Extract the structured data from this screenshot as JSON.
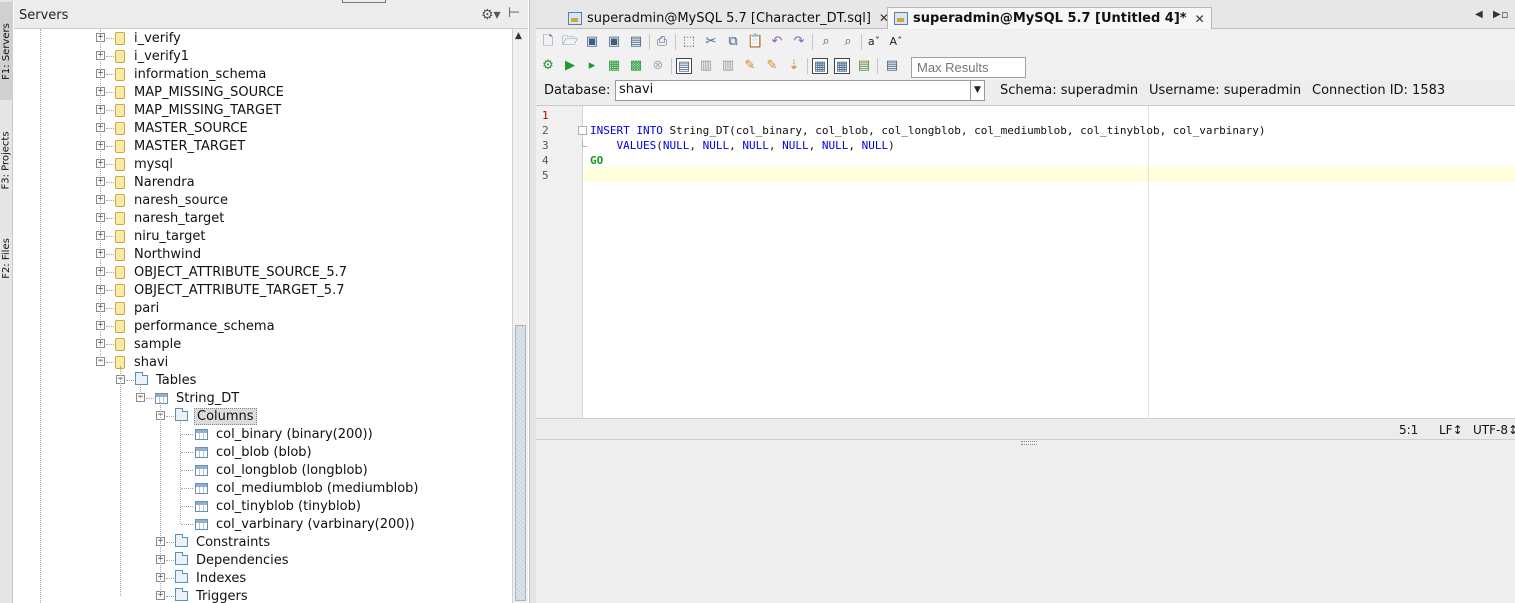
{
  "side_tabs": {
    "servers": "F1: Servers",
    "projects": "F3: Projects",
    "files": "F2: Files"
  },
  "servers_panel": {
    "title": "Servers",
    "tree": [
      {
        "label": "i_verify",
        "type": "database",
        "expanded": false
      },
      {
        "label": "i_verify1",
        "type": "database",
        "expanded": false
      },
      {
        "label": "information_schema",
        "type": "database",
        "expanded": false
      },
      {
        "label": "MAP_MISSING_SOURCE",
        "type": "database",
        "expanded": false
      },
      {
        "label": "MAP_MISSING_TARGET",
        "type": "database",
        "expanded": false
      },
      {
        "label": "MASTER_SOURCE",
        "type": "database",
        "expanded": false
      },
      {
        "label": "MASTER_TARGET",
        "type": "database",
        "expanded": false
      },
      {
        "label": "mysql",
        "type": "database",
        "expanded": false
      },
      {
        "label": "Narendra",
        "type": "database",
        "expanded": false
      },
      {
        "label": "naresh_source",
        "type": "database",
        "expanded": false
      },
      {
        "label": "naresh_target",
        "type": "database",
        "expanded": false
      },
      {
        "label": "niru_target",
        "type": "database",
        "expanded": false
      },
      {
        "label": "Northwind",
        "type": "database",
        "expanded": false
      },
      {
        "label": "OBJECT_ATTRIBUTE_SOURCE_5.7",
        "type": "database",
        "expanded": false
      },
      {
        "label": "OBJECT_ATTRIBUTE_TARGET_5.7",
        "type": "database",
        "expanded": false
      },
      {
        "label": "pari",
        "type": "database",
        "expanded": false
      },
      {
        "label": "performance_schema",
        "type": "database",
        "expanded": false
      },
      {
        "label": "sample",
        "type": "database",
        "expanded": false
      },
      {
        "label": "shavi",
        "type": "database",
        "expanded": true
      },
      {
        "label": "Tables",
        "type": "folder",
        "expanded": true
      },
      {
        "label": "String_DT",
        "type": "table",
        "expanded": true
      },
      {
        "label": "Columns",
        "type": "folder",
        "expanded": true,
        "selected": true
      },
      {
        "label": "col_binary (binary(200))",
        "type": "column"
      },
      {
        "label": "col_blob (blob)",
        "type": "column"
      },
      {
        "label": "col_longblob (longblob)",
        "type": "column"
      },
      {
        "label": "col_mediumblob (mediumblob)",
        "type": "column"
      },
      {
        "label": "col_tinyblob (tinyblob)",
        "type": "column"
      },
      {
        "label": "col_varbinary (varbinary(200))",
        "type": "column"
      },
      {
        "label": "Constraints",
        "type": "folder",
        "expanded": false
      },
      {
        "label": "Dependencies",
        "type": "folder",
        "expanded": false
      },
      {
        "label": "Indexes",
        "type": "folder",
        "expanded": false
      },
      {
        "label": "Triggers",
        "type": "folder",
        "expanded": false
      }
    ]
  },
  "editor_tabs": [
    {
      "label": "superadmin@MySQL 5.7  [Character_DT.sql]",
      "active": false
    },
    {
      "label": "superadmin@MySQL 5.7 [Untitled 4]*",
      "active": true
    }
  ],
  "toolbar": {
    "max_results_placeholder": "Max Results"
  },
  "db_bar": {
    "database_label": "Database:",
    "database_value": "shavi",
    "schema": "Schema:  superadmin",
    "username": "Username:  superadmin",
    "connection_id": "Connection ID:  1583"
  },
  "editor": {
    "line_numbers": [
      "1",
      "2",
      "3",
      "4",
      "5"
    ],
    "line2_kw1": "INSERT",
    "line2_kw2": "INTO",
    "line2_rest": " String_DT(col_binary, col_blob, col_longblob, col_mediumblob, col_tinyblob, col_varbinary)",
    "line3_indent": "    ",
    "line3_kw": "VALUES",
    "line3_rest_open": "(",
    "null_kw": "NULL",
    "line3_close": ")",
    "line4_kw": "GO"
  },
  "status": {
    "position": "5:1",
    "eol": "LF↕",
    "encoding": "UTF-8↕"
  },
  "colors": {
    "keyword": "#0000e6",
    "go_keyword": "#1a9c1a",
    "current_line": "#ffffdc"
  }
}
